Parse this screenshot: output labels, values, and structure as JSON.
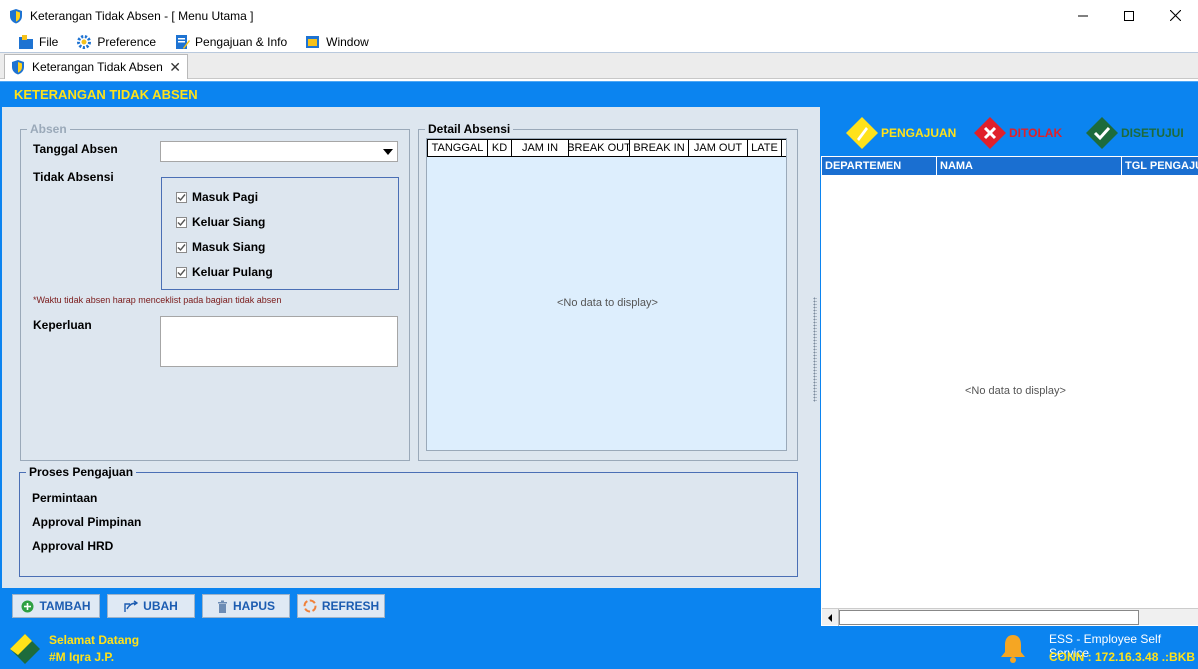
{
  "window": {
    "title": "Keterangan Tidak Absen - [ Menu Utama ]"
  },
  "menu": [
    {
      "label": "File",
      "icon": "folder-icon"
    },
    {
      "label": "Preference",
      "icon": "gear-icon"
    },
    {
      "label": "Pengajuan & Info",
      "icon": "edit-document-icon"
    },
    {
      "label": "Window",
      "icon": "window-icon"
    }
  ],
  "tab": {
    "label": "Keterangan Tidak Absen"
  },
  "header": {
    "title": "KETERANGAN TIDAK ABSEN"
  },
  "absen": {
    "legend": "Absen",
    "tanggal_label": "Tanggal Absen",
    "tanggal_value": "",
    "tidak_absensi_label": "Tidak Absensi",
    "checks": [
      {
        "label": "Masuk Pagi",
        "checked": true
      },
      {
        "label": "Keluar Siang",
        "checked": true
      },
      {
        "label": "Masuk Siang",
        "checked": true
      },
      {
        "label": "Keluar Pulang",
        "checked": true
      }
    ],
    "note": "*Waktu tidak absen harap menceklist pada bagian tidak absen",
    "keperluan_label": "Keperluan",
    "keperluan_value": ""
  },
  "detail": {
    "legend": "Detail Absensi",
    "columns": [
      "TANGGAL",
      "KD",
      "JAM IN",
      "BREAK OUT",
      "BREAK IN",
      "JAM OUT",
      "LATE"
    ],
    "empty_text": "<No data to display>"
  },
  "proses": {
    "legend": "Proses Pengajuan",
    "items": [
      "Permintaan",
      "Approval Pimpinan",
      "Approval HRD"
    ]
  },
  "buttons": {
    "tambah": "TAMBAH",
    "ubah": "UBAH",
    "hapus": "HAPUS",
    "refresh": "REFRESH"
  },
  "right": {
    "status": [
      {
        "label": "PENGAJUAN",
        "color": "#ffe21a",
        "icon": "pencil-diamond-icon"
      },
      {
        "label": "DITOLAK",
        "color": "#e0202a",
        "icon": "x-diamond-icon"
      },
      {
        "label": "DISETUJUI",
        "color": "#1d6b3c",
        "icon": "check-diamond-icon"
      }
    ],
    "columns": [
      "DEPARTEMEN",
      "NAMA",
      "TGL PENGAJUAN"
    ],
    "empty_text": "<No data to display>"
  },
  "statusbar": {
    "welcome": "Selamat Datang",
    "user": "#M Iqra J.P.",
    "app_name": "ESS - Employee Self Service",
    "conn": "CONN : 172.16.3.48 .:BKB"
  },
  "colors": {
    "accent": "#0b84f0",
    "header_text": "#ffe21a"
  }
}
